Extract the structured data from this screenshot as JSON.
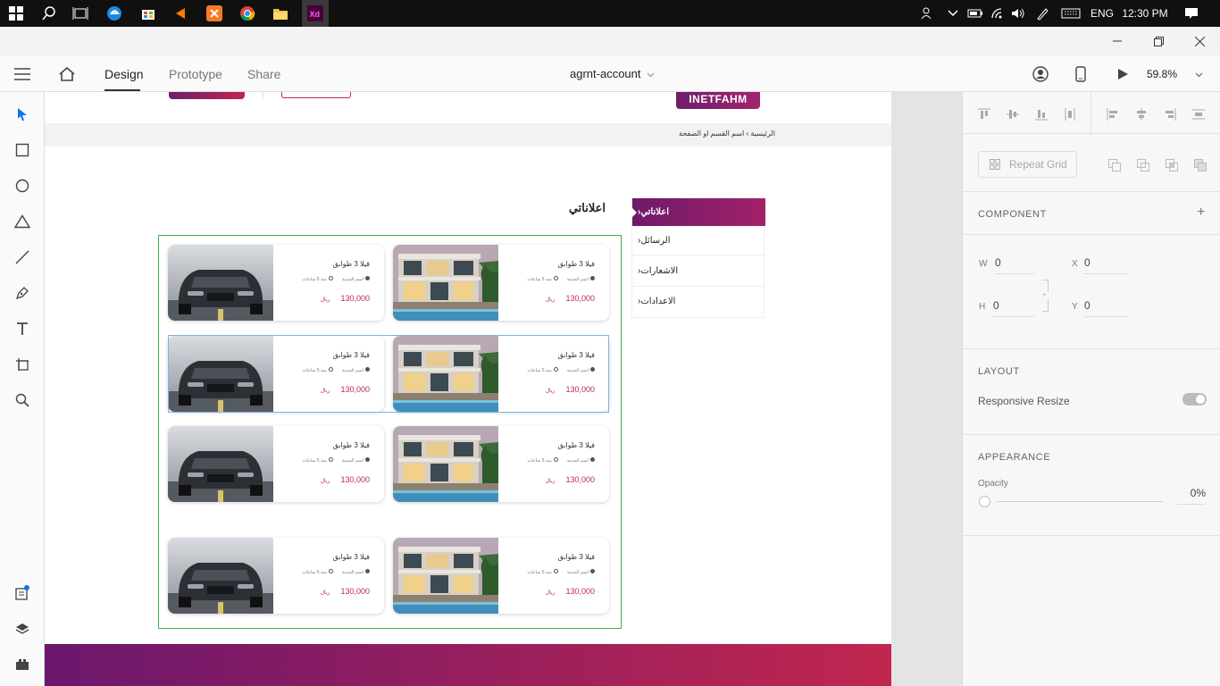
{
  "taskbar": {
    "language": "ENG",
    "time": "12:30 PM",
    "apps": [
      "start-icon",
      "search-icon",
      "task-view-icon",
      "edge-icon",
      "store-icon",
      "media-icon",
      "xampp-icon",
      "chrome-icon",
      "file-explorer-icon",
      "adobe-xd-icon"
    ]
  },
  "appbar": {
    "tabs": [
      "Design",
      "Prototype",
      "Share"
    ],
    "document_name": "agrnt-account",
    "zoom": "59.8%"
  },
  "artboard": {
    "logo_text": "INETFAHM",
    "breadcrumb": "الرئيسية  ›  اسم القسم او الصفحة",
    "page_title": "اعلاناتي",
    "menu": [
      {
        "label": "اعلاناتي",
        "active": true
      },
      {
        "label": "الرسائل",
        "active": false
      },
      {
        "label": "الاشعارات",
        "active": false
      },
      {
        "label": "الاعدادات",
        "active": false
      }
    ],
    "listing": {
      "title": "فيلا 3 طوابق",
      "location": "اسم المدينة",
      "time": "منذ 5 ساعات",
      "price": "130,000",
      "currency": "ريال"
    }
  },
  "panel": {
    "repeat_grid": "Repeat Grid",
    "component_label": "COMPONENT",
    "w_label": "W",
    "w_value": "0",
    "x_label": "X",
    "x_value": "0",
    "h_label": "H",
    "h_value": "0",
    "y_label": "Y",
    "y_value": "0",
    "layout_label": "LAYOUT",
    "responsive_resize": "Responsive Resize",
    "appearance_label": "APPEARANCE",
    "opacity_label": "Opacity",
    "opacity_value": "0%"
  },
  "colors": {
    "brand_purple": "#6e1e6e",
    "brand_red": "#c0264f",
    "selection_green": "#3bb54a",
    "selection_blue": "#7fb3e8"
  }
}
